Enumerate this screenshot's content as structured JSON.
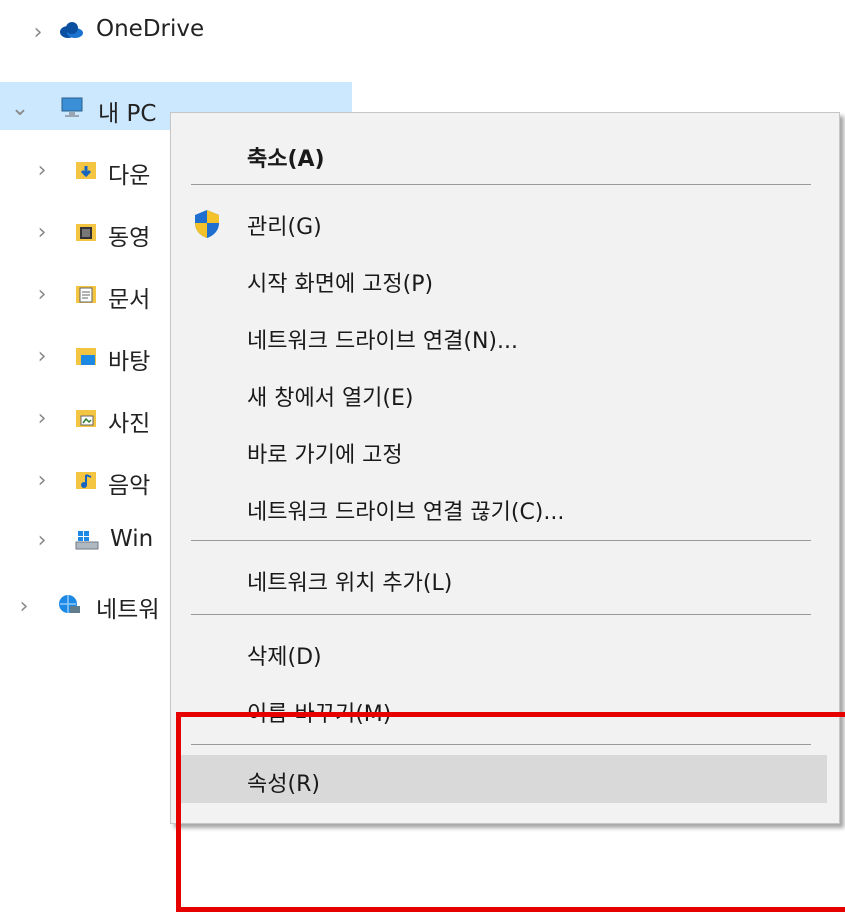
{
  "tree": {
    "items": [
      {
        "label": "OneDrive",
        "icon": "onedrive-icon",
        "expanded": false
      },
      {
        "label": "내 PC",
        "icon": "pc-icon",
        "expanded": true,
        "selected": true
      },
      {
        "label": "다운",
        "icon": "downloads-folder-icon",
        "expanded": false
      },
      {
        "label": "동영",
        "icon": "videos-folder-icon",
        "expanded": false
      },
      {
        "label": "문서",
        "icon": "documents-folder-icon",
        "expanded": false
      },
      {
        "label": "바탕",
        "icon": "desktop-folder-icon",
        "expanded": false
      },
      {
        "label": "사진",
        "icon": "pictures-folder-icon",
        "expanded": false
      },
      {
        "label": "음악",
        "icon": "music-folder-icon",
        "expanded": false
      },
      {
        "label": "Win",
        "icon": "windows-drive-icon",
        "expanded": false
      },
      {
        "label": "네트워",
        "icon": "network-icon",
        "expanded": false
      }
    ]
  },
  "context_menu": {
    "items": [
      {
        "label": "축소(A)",
        "bold": true
      },
      {
        "label": "관리(G)",
        "icon": "uac-shield-icon"
      },
      {
        "label": "시작 화면에 고정(P)"
      },
      {
        "label": "네트워크 드라이브 연결(N)..."
      },
      {
        "label": "새 창에서 열기(E)"
      },
      {
        "label": "바로 가기에 고정"
      },
      {
        "label": "네트워크 드라이브 연결 끊기(C)..."
      },
      {
        "label": "네트워크 위치 추가(L)"
      },
      {
        "label": "삭제(D)"
      },
      {
        "label": "이름 바꾸기(M)"
      },
      {
        "label": "속성(R)",
        "highlighted": true
      }
    ]
  },
  "colors": {
    "selection": "#cce8ff",
    "menu_bg": "#f2f2f2",
    "menu_hover": "#d9d9d9",
    "annotation": "#e60000"
  }
}
